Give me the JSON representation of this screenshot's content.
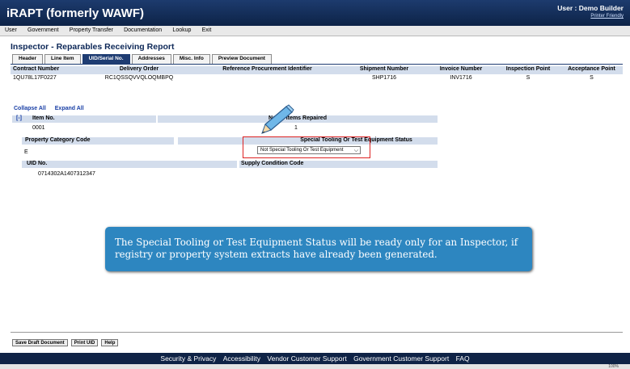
{
  "header": {
    "title": "iRAPT (formerly WAWF)",
    "user": "User : Demo Builder",
    "printer_friendly": "Printer Friendly"
  },
  "menu": [
    "User",
    "Government",
    "Property Transfer",
    "Documentation",
    "Lookup",
    "Exit"
  ],
  "page_title": "Inspector - Reparables Receiving Report",
  "tabs": [
    "Header",
    "Line Item",
    "UID/Serial No.",
    "Addresses",
    "Misc. Info",
    "Preview Document"
  ],
  "contract_table": {
    "headers": [
      "Contract Number",
      "Delivery Order",
      "Reference Procurement Identifier",
      "Shipment Number",
      "Invoice Number",
      "Inspection Point",
      "Acceptance Point"
    ],
    "row": [
      "1QU78L17F0227",
      "RC1QSSQVVQLOQMBPQ",
      "",
      "SHP1716",
      "INV1716",
      "S",
      "S"
    ]
  },
  "links": {
    "collapse_all": "Collapse All",
    "expand_all": "Expand All"
  },
  "item": {
    "toggle": "[-]",
    "item_no_label": "Item No.",
    "items_repaired_label": "No. of Items Repaired",
    "item_no": "0001",
    "items_repaired": "1",
    "property_category_label": "Property Category Code",
    "stte_label": "Special Tooling Or Test Equipment Status",
    "property_category": "E",
    "stte_value": "Not Special Tooling Or Test Equipment",
    "uid_label": "UID No.",
    "supply_condition_label": "Supply Condition Code",
    "uid": "0714302A1407312347"
  },
  "callout": "The Special Tooling or Test Equipment Status will be ready only for an Inspector, if registry or property system extracts have already been generated.",
  "buttons": [
    "Save Draft Document",
    "Print UID",
    "Help"
  ],
  "footer": [
    "Security & Privacy",
    "Accessibility",
    "Vendor Customer Support",
    "Government Customer Support",
    "FAQ"
  ],
  "zoom": "100%",
  "colors": {
    "header_bg": "#0d2347",
    "band_bg": "#d3ddec",
    "callout_bg": "#2d86c0",
    "highlight": "#d22222"
  }
}
